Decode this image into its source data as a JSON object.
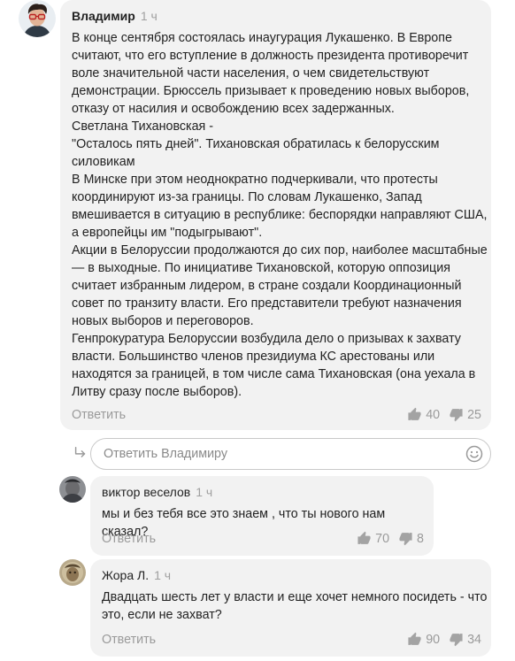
{
  "comments": [
    {
      "author": "Владимир",
      "time": "1 ч",
      "lines": [
        "В конце сентября состоялась инаугурация Лукашенко. В Европе",
        "считают, что его вступление в должность президента противоречит",
        "воле значительной части населения, о чем свидетельствуют",
        "демонстрации. Брюссель призывает к проведению новых выборов,",
        "отказу от насилия и освобождению всех задержанных.",
        "Светлана Тихановская -",
        "\"Осталось пять дней\". Тихановская обратилась к белорусским",
        "силовикам",
        "В Минске при этом неоднократно подчеркивали, что протесты",
        "координируют из-за границы. По словам Лукашенко, Запад",
        "вмешивается в ситуацию в республике: беспорядки направляют США,",
        "а европейцы им \"подыгрывают\".",
        "Акции в Белоруссии продолжаются до сих пор, наиболее масштабные",
        "— в выходные. По инициативе Тихановской, которую оппозиция",
        "считает избранным лидером, в стране создали Координационный",
        "совет по транзиту власти. Его представители требуют назначения",
        "новых выборов и переговоров.",
        "Генпрокуратура Белоруссии возбудила дело о призывах к захвату",
        "власти. Большинство членов президиума КС арестованы или",
        "находятся за границей, в том числе сама Тихановская (она уехала в",
        "Литву сразу после выборов)."
      ],
      "reply_label": "Ответить",
      "likes": "40",
      "dislikes": "25"
    },
    {
      "author": "виктор веселов",
      "time": "1 ч",
      "lines": [
        "мы и без тебя все это знаем , что ты нового нам сказал?"
      ],
      "reply_label": "Ответить",
      "likes": "70",
      "dislikes": "8"
    },
    {
      "author": "Жора Л.",
      "time": "1 ч",
      "lines": [
        "Двадцать шесть лет у власти и еще хочет немного посидеть - что",
        "это, если не захват?"
      ],
      "reply_label": "Ответить",
      "likes": "90",
      "dislikes": "34"
    }
  ],
  "reply_input": {
    "placeholder": "Ответить Владимиру",
    "value": ""
  },
  "icons": {
    "like": "thumbs-up-icon",
    "dislike": "thumbs-down-icon",
    "reply_arrow": "reply-arrow-icon",
    "emoji": "smiley-icon"
  },
  "colors": {
    "bubble": "#f2f2f2",
    "muted_text": "#9a9a9a",
    "input_border": "#c9c9c9"
  }
}
